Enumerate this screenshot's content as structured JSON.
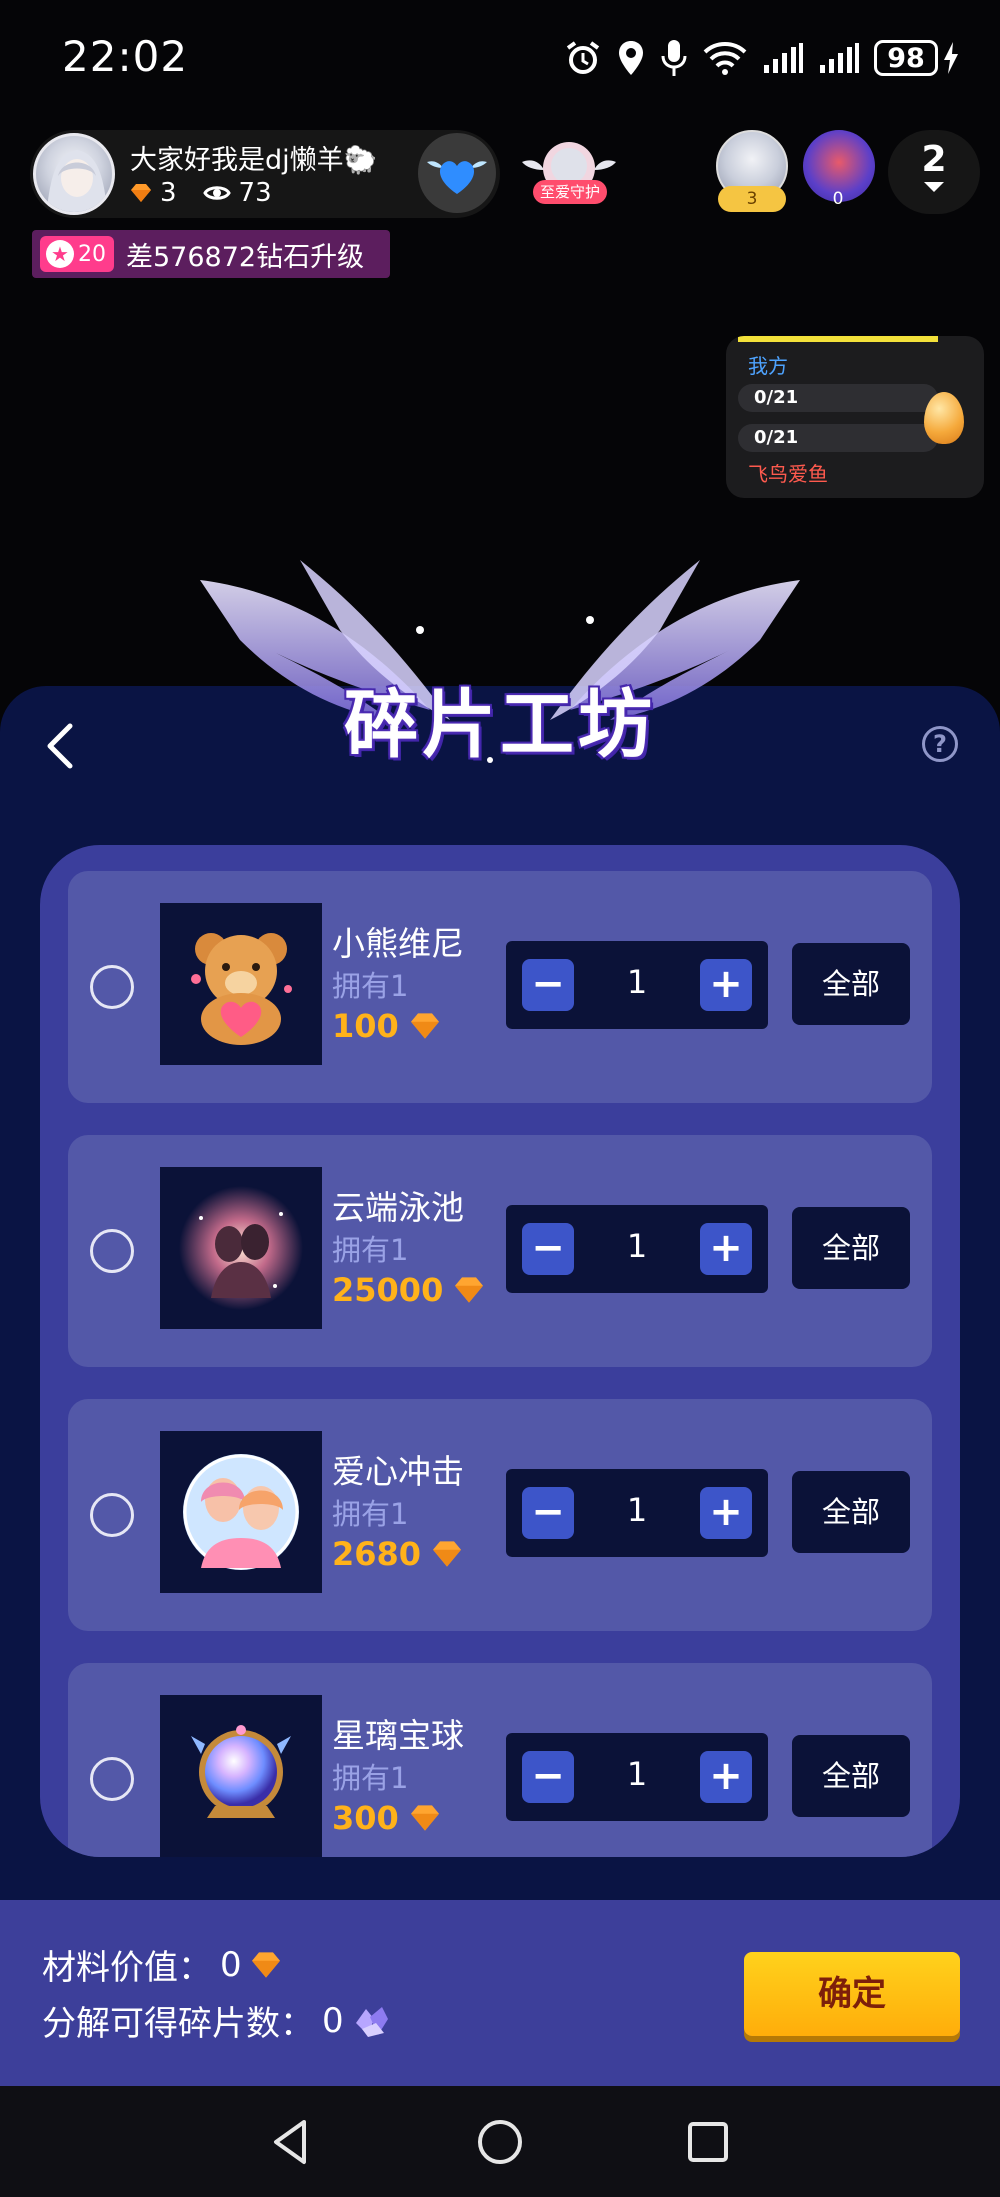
{
  "status_bar": {
    "time": "22:02",
    "battery": "98",
    "icons": [
      "alarm-icon",
      "location-icon",
      "mic-icon",
      "wifi-icon",
      "signal-icon",
      "signal-icon",
      "charging-icon"
    ]
  },
  "live_header": {
    "host_name": "大家好我是dj懒羊🐑",
    "diamonds": "3",
    "views": "73",
    "guard_label": "至爱守护",
    "viewers": [
      {
        "badge": "3"
      },
      {
        "badge": "0"
      }
    ],
    "viewer_count": "2",
    "level": "20",
    "level_text": "差576872钻石升级"
  },
  "pk_panel": {
    "our_side": "我方",
    "rows": [
      "0/21",
      "0/21"
    ],
    "opponent": "飞鸟爱鱼"
  },
  "workshop": {
    "title": "碎片工坊",
    "help": "?",
    "items": [
      {
        "name": "小熊维尼",
        "owned": "拥有1",
        "price": "100",
        "qty": "1",
        "all_label": "全部"
      },
      {
        "name": "云端泳池",
        "owned": "拥有1",
        "price": "25000",
        "qty": "1",
        "all_label": "全部"
      },
      {
        "name": "爱心冲击",
        "owned": "拥有1",
        "price": "2680",
        "qty": "1",
        "all_label": "全部"
      },
      {
        "name": "星璃宝球",
        "owned": "拥有1",
        "price": "300",
        "qty": "1",
        "all_label": "全部"
      }
    ]
  },
  "footer": {
    "material_label": "材料价值：",
    "material_value": "0",
    "fragments_label": "分解可得碎片数：",
    "fragments_value": "0",
    "confirm": "确定"
  },
  "colors": {
    "panel_bg": "#0a1444",
    "list_bg": "#3b3e9c",
    "item_bg": "#5358a8",
    "price": "#ffb21a",
    "confirm": "#ffc20f"
  }
}
